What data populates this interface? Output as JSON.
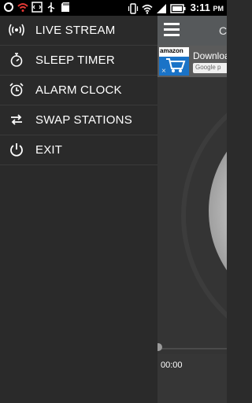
{
  "status_bar": {
    "time": "3:11",
    "time_suffix": "PM",
    "icons_left": [
      "sync-icon",
      "wifi-alert-icon",
      "code-icon",
      "usb-icon",
      "sd-card-icon"
    ],
    "icons_right": [
      "vibrate-icon",
      "wifi-icon",
      "signal-icon",
      "battery-icon"
    ]
  },
  "background_app": {
    "title": "C",
    "ad": {
      "logo_text": "amazon",
      "close_glyph": "×",
      "text": "Downloa",
      "badge": "Google p"
    },
    "elapsed_time": "00:00"
  },
  "drawer": {
    "items": [
      {
        "label": "LIVE STREAM",
        "icon": "broadcast-icon"
      },
      {
        "label": "SLEEP TIMER",
        "icon": "stopwatch-icon"
      },
      {
        "label": "ALARM CLOCK",
        "icon": "alarm-clock-icon"
      },
      {
        "label": "SWAP STATIONS",
        "icon": "swap-icon"
      },
      {
        "label": "EXIT",
        "icon": "power-icon"
      }
    ]
  }
}
